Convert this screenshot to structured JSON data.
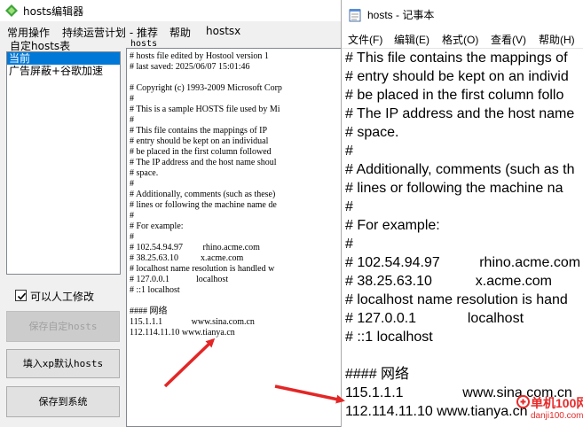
{
  "editor": {
    "title": "hosts编辑器",
    "menu": [
      "常用操作",
      "持续运营计划 - 推荐",
      "帮助",
      "hostsx"
    ],
    "group_label": "自定hosts表",
    "profiles": [
      "当前",
      "广告屏蔽+谷歌加速"
    ],
    "selected_profile": 0,
    "manual_edit_label": "可以人工修改",
    "manual_edit_checked": true,
    "save_custom_label": "保存自定hosts",
    "fill_xp_label": "填入xp默认hosts",
    "save_system_label": "保存到系统",
    "text_label": "hosts",
    "lines": [
      "# hosts file edited by Hostool version 1",
      "# last saved: 2025/06/07 15:01:46",
      "",
      "# Copyright (c) 1993-2009 Microsoft Corp",
      "#",
      "# This is a sample HOSTS file used by Mi",
      "#",
      "# This file contains the mappings of IP",
      "# entry should be kept on an individual",
      "# be placed in the first column followed",
      "# The IP address and the host name shoul",
      "# space.",
      "#",
      "# Additionally, comments (such as these)",
      "# lines or following the machine name de",
      "#",
      "# For example:",
      "#",
      "# 102.54.94.97         rhino.acme.com",
      "# 38.25.63.10          x.acme.com",
      "# localhost name resolution is handled w",
      "# 127.0.0.1            localhost",
      "# ::1 localhost",
      "",
      "#### 网络",
      "115.1.1.1             www.sina.com.cn",
      "112.114.11.10 www.tianya.cn"
    ]
  },
  "notepad": {
    "title": "hosts - 记事本",
    "menu": [
      "文件(F)",
      "编辑(E)",
      "格式(O)",
      "查看(V)",
      "帮助(H)"
    ],
    "lines": [
      "# This file contains the mappings of",
      "# entry should be kept on an individ",
      "# be placed in the first column follo",
      "# The IP address and the host name",
      "# space.",
      "#",
      "# Additionally, comments (such as th",
      "# lines or following the machine na",
      "#",
      "# For example:",
      "#",
      "# 102.54.94.97          rhino.acme.com",
      "# 38.25.63.10           x.acme.com",
      "# localhost name resolution is hand",
      "# 127.0.0.1             localhost",
      "# ::1 localhost",
      "",
      "#### 网络",
      "115.1.1.1               www.sina.com.cn",
      "112.114.11.10 www.tianya.cn"
    ]
  },
  "watermark": {
    "brand": "单机100网",
    "url": "danji100.com"
  },
  "colors": {
    "selection": "#0078d7",
    "arrow": "#e32626",
    "watermark": "#e62a2a"
  }
}
